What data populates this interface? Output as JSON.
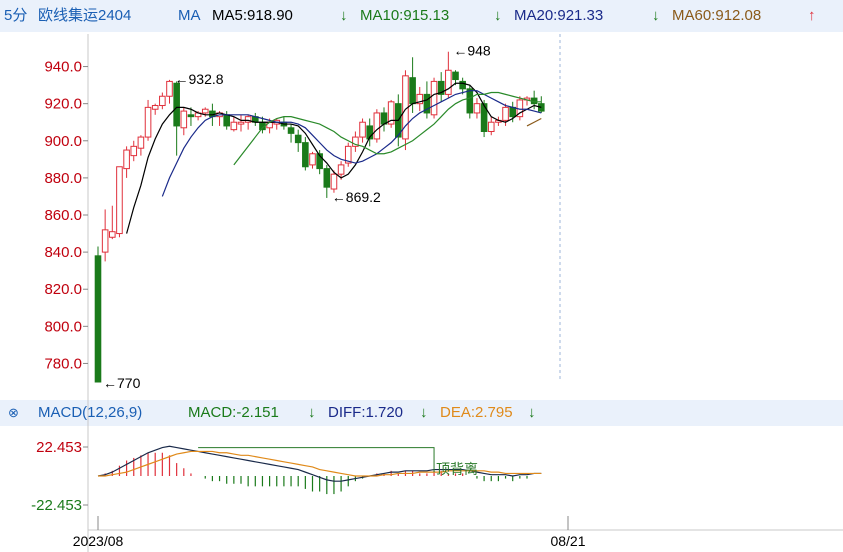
{
  "header": {
    "period": "5分",
    "symbol": "欧线集运2404",
    "ma_label": "MA",
    "ma5": "MA5:918.90",
    "ma10": "MA10:915.13",
    "ma20": "MA20:921.33",
    "ma60": "MA60:912.08",
    "arrow_down": "↓",
    "arrow_up": "↑"
  },
  "macd_header": {
    "title": "MACD(12,26,9)",
    "macd": "MACD:-2.151",
    "diff": "DIFF:1.720",
    "dea": "DEA:2.795",
    "arrow_down": "↓"
  },
  "colors": {
    "up": "#e0303b",
    "down": "#1a7a1a",
    "ma5": "#000000",
    "ma10": "#1a2a8a",
    "ma20": "#2a8a2a",
    "ma60": "#8a5a1a",
    "axis_text": "#c0000e",
    "header_bg": "#eaf1fb"
  },
  "chart_data": [
    {
      "type": "candlestick",
      "y_ticks": [
        "940.0",
        "920.0",
        "900.0",
        "880.0",
        "860.0",
        "840.0",
        "820.0",
        "800.0",
        "780.0"
      ],
      "ylim": [
        770,
        950
      ],
      "annotations": [
        {
          "label": "←770",
          "price": 770
        },
        {
          "label": "←932.8",
          "price": 932.8
        },
        {
          "label": "←869.2",
          "price": 869.2
        },
        {
          "label": "←948",
          "price": 948
        }
      ],
      "x_labels": [
        "2023/08",
        "08/21"
      ],
      "candles": [
        [
          838,
          770,
          770,
          843
        ],
        [
          840,
          852,
          835,
          863
        ],
        [
          848,
          851,
          847,
          865
        ],
        [
          850,
          886,
          848,
          886
        ],
        [
          885,
          895,
          880,
          897
        ],
        [
          892,
          897,
          889,
          900
        ],
        [
          896,
          902,
          892,
          903
        ],
        [
          902,
          918,
          900,
          922
        ],
        [
          917,
          919,
          914,
          920
        ],
        [
          919,
          924,
          917,
          926
        ],
        [
          924,
          932,
          920,
          932.8
        ],
        [
          931,
          908,
          892,
          932
        ],
        [
          907,
          916,
          903,
          918
        ],
        [
          914,
          913,
          908,
          918
        ],
        [
          913,
          915,
          911,
          916
        ],
        [
          915,
          917,
          913,
          918
        ],
        [
          916,
          913,
          908,
          920
        ],
        [
          913,
          915,
          908,
          916
        ],
        [
          914,
          908,
          906,
          916
        ],
        [
          906,
          910,
          905,
          913
        ],
        [
          909,
          910,
          905,
          914
        ],
        [
          910,
          913,
          906,
          914
        ],
        [
          913,
          910,
          908,
          915
        ],
        [
          910,
          906,
          904,
          913
        ],
        [
          907,
          910,
          904,
          912
        ],
        [
          909,
          911,
          906,
          912
        ],
        [
          910,
          908,
          906,
          913
        ],
        [
          907,
          904,
          899,
          909
        ],
        [
          903,
          899,
          894,
          906
        ],
        [
          899,
          886,
          884,
          902
        ],
        [
          887,
          893,
          885,
          894
        ],
        [
          893,
          885,
          882,
          895
        ],
        [
          885,
          875,
          869.2,
          887
        ],
        [
          874,
          882,
          872,
          884
        ],
        [
          882,
          887,
          879,
          889
        ],
        [
          888,
          897,
          886,
          899
        ],
        [
          897,
          902,
          894,
          905
        ],
        [
          902,
          910,
          899,
          912
        ],
        [
          908,
          901,
          897,
          912
        ],
        [
          901,
          915,
          899,
          917
        ],
        [
          915,
          909,
          905,
          918
        ],
        [
          909,
          921,
          907,
          922
        ],
        [
          920,
          902,
          897,
          925
        ],
        [
          901,
          935,
          895,
          938
        ],
        [
          934,
          920,
          915,
          945
        ],
        [
          920,
          925,
          916,
          929
        ],
        [
          925,
          915,
          912,
          932
        ],
        [
          914,
          932,
          912,
          934
        ],
        [
          932,
          925,
          921,
          937
        ],
        [
          925,
          938,
          923,
          948
        ],
        [
          937,
          933,
          930,
          938
        ],
        [
          932,
          928,
          925,
          934
        ],
        [
          928,
          915,
          912,
          930
        ],
        [
          915,
          920,
          912,
          923
        ],
        [
          920,
          905,
          902,
          922
        ],
        [
          905,
          910,
          903,
          913
        ],
        [
          910,
          911,
          908,
          913
        ],
        [
          911,
          918,
          908,
          920
        ],
        [
          918,
          913,
          910,
          921
        ],
        [
          913,
          922,
          911,
          924
        ],
        [
          922,
          923,
          919,
          924
        ],
        [
          923,
          920,
          917,
          927
        ],
        [
          920,
          916,
          915,
          924
        ]
      ],
      "ma5": [
        null,
        null,
        null,
        null,
        850,
        864,
        876,
        891,
        901,
        909,
        914,
        918,
        918,
        917,
        915,
        914,
        914,
        915,
        914,
        913,
        911,
        911,
        910,
        910,
        910,
        910,
        909,
        909,
        908,
        904,
        898,
        892,
        888,
        883,
        880,
        882,
        887,
        894,
        902,
        906,
        909,
        911,
        911,
        917,
        920,
        921,
        922,
        925,
        926,
        928,
        931,
        931,
        930,
        926,
        919,
        913,
        911,
        910,
        912,
        915,
        917,
        919,
        918
      ],
      "ma10": [
        null,
        null,
        null,
        null,
        null,
        null,
        null,
        null,
        null,
        870,
        880,
        888,
        896,
        902,
        907,
        911,
        913,
        914,
        914,
        914,
        914,
        914,
        913,
        912,
        911,
        910,
        910,
        910,
        909,
        907,
        903,
        899,
        895,
        892,
        890,
        889,
        888,
        889,
        891,
        893,
        896,
        899,
        903,
        908,
        912,
        915,
        917,
        919,
        921,
        923,
        925,
        926,
        927,
        927,
        925,
        923,
        921,
        919,
        918,
        917,
        917,
        916,
        915
      ],
      "ma20": [
        null,
        null,
        null,
        null,
        null,
        null,
        null,
        null,
        null,
        null,
        null,
        null,
        null,
        null,
        null,
        null,
        null,
        null,
        null,
        887,
        892,
        897,
        902,
        907,
        910,
        912,
        913,
        913,
        912,
        911,
        910,
        909,
        907,
        905,
        902,
        900,
        898,
        897,
        895,
        893,
        893,
        894,
        896,
        898,
        900,
        903,
        906,
        909,
        913,
        917,
        920,
        922,
        923,
        925,
        925,
        926,
        926,
        925,
        924,
        923,
        922,
        921,
        921
      ],
      "ma60": [
        null,
        null,
        null,
        null,
        null,
        null,
        null,
        null,
        null,
        null,
        null,
        null,
        null,
        null,
        null,
        null,
        null,
        null,
        null,
        null,
        null,
        null,
        null,
        null,
        null,
        null,
        null,
        null,
        null,
        null,
        null,
        null,
        null,
        null,
        null,
        null,
        null,
        null,
        null,
        null,
        null,
        null,
        null,
        null,
        null,
        null,
        null,
        null,
        null,
        null,
        null,
        null,
        null,
        null,
        null,
        null,
        null,
        null,
        null,
        null,
        908,
        910,
        912
      ]
    },
    {
      "type": "macd",
      "y_ticks": [
        "22.453",
        "-22.453"
      ],
      "ylim": [
        -22.453,
        22.453
      ],
      "annotations": [
        {
          "label": "顶背离"
        }
      ],
      "diff": [
        0,
        1,
        3,
        6,
        9,
        12,
        15,
        18,
        20,
        22,
        23,
        22,
        21,
        20,
        19,
        18,
        17,
        16,
        15,
        14,
        13,
        12,
        11,
        10,
        9,
        8,
        7,
        6,
        5,
        3,
        1,
        -1,
        -3,
        -4,
        -4,
        -3,
        -2,
        -1,
        0,
        1,
        2,
        3,
        3,
        4,
        4,
        4,
        4,
        5,
        5,
        5,
        5,
        5,
        4,
        3,
        2,
        1,
        1,
        1,
        0,
        1,
        1,
        2,
        2
      ],
      "dea": [
        0,
        0,
        1,
        2,
        3,
        5,
        7,
        9,
        11,
        13,
        15,
        17,
        18,
        19,
        19,
        19,
        19,
        18,
        18,
        17,
        16,
        16,
        15,
        14,
        13,
        12,
        11,
        10,
        9,
        8,
        7,
        5,
        4,
        3,
        2,
        1,
        0,
        0,
        0,
        0,
        1,
        1,
        2,
        2,
        2,
        3,
        3,
        3,
        3,
        4,
        4,
        4,
        4,
        4,
        4,
        3,
        3,
        2,
        2,
        2,
        2,
        2,
        2
      ],
      "macd": [
        0,
        2,
        4,
        8,
        12,
        14,
        16,
        18,
        18,
        18,
        16,
        10,
        6,
        2,
        0,
        -2,
        -4,
        -4,
        -6,
        -6,
        -6,
        -8,
        -8,
        -8,
        -8,
        -8,
        -8,
        -8,
        -8,
        -10,
        -12,
        -12,
        -14,
        -14,
        -12,
        -8,
        -4,
        -2,
        0,
        2,
        2,
        4,
        2,
        4,
        4,
        2,
        2,
        4,
        4,
        2,
        2,
        2,
        0,
        -2,
        -4,
        -4,
        -4,
        -2,
        -4,
        -2,
        -2,
        0,
        0
      ]
    }
  ]
}
